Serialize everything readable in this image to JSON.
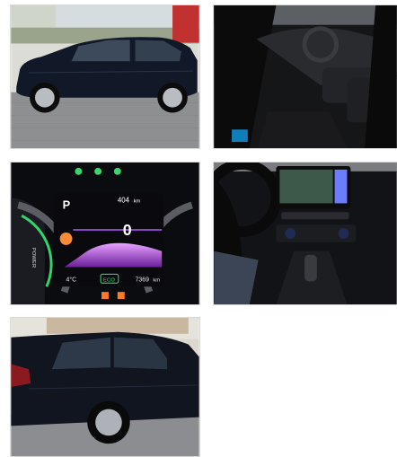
{
  "gallery": {
    "cluster": {
      "gear": "P",
      "range": "404",
      "range_unit": "km",
      "speed": "0",
      "temp": "4°C",
      "mode": "ECO",
      "odometer": "7369",
      "odometer_unit": "km",
      "power_label": "POWER"
    }
  },
  "colors": {
    "car_body": "#101726",
    "sky": "#e9e6df",
    "pavement": "#8f8f8f",
    "interior": "#1b1b1d",
    "cluster_purple": "#c66bff",
    "cluster_green": "#3fe07b",
    "warning_orange": "#ff7a22"
  }
}
